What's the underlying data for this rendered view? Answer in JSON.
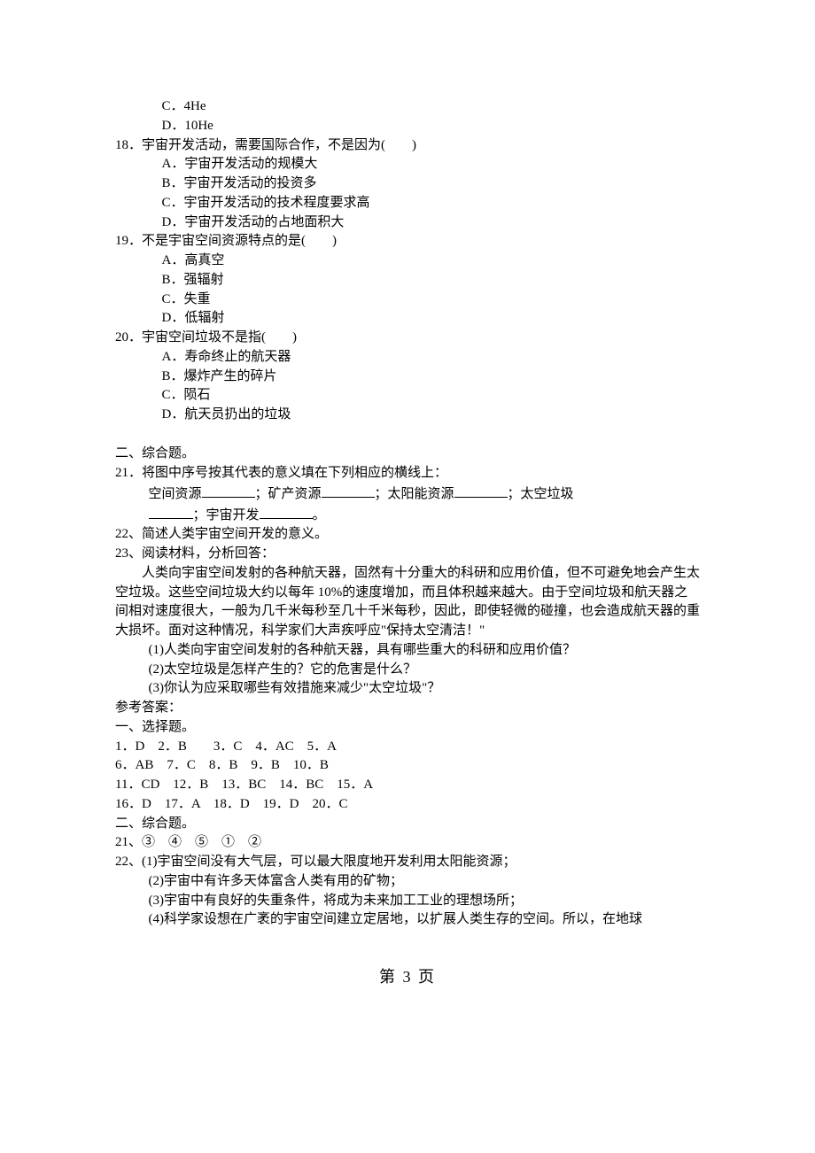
{
  "options": {
    "o1": "C．4He",
    "o2": "D．10He"
  },
  "q18": {
    "stem": "18．宇宙开发活动，需要国际合作，不是因为(　　)",
    "a": "A．宇宙开发活动的规模大",
    "b": "B．宇宙开发活动的投资多",
    "c": "C．宇宙开发活动的技术程度要求高",
    "d": "D．宇宙开发活动的占地面积大"
  },
  "q19": {
    "stem": "19．不是宇宙空间资源特点的是(　　)",
    "a": "A．高真空",
    "b": "B．强辐射",
    "c": "C．失重",
    "d": "D．低辐射"
  },
  "q20": {
    "stem": "20．宇宙空间垃圾不是指(　　)",
    "a": "A．寿命终止的航天器",
    "b": "B．爆炸产生的碎片",
    "c": "C．陨石",
    "d": "D．航天员扔出的垃圾"
  },
  "section2": "二、综合题。",
  "q21": {
    "stem": "21．将图中序号按其代表的意义填在下列相应的横线上：",
    "line1a": "空间资源",
    "line1b": "；矿产资源",
    "line1c": "；太阳能资源",
    "line1d": "；太空垃圾",
    "line2a": "；宇宙开发",
    "line2b": "。"
  },
  "q22": "22、简述人类宇宙空间开发的意义。",
  "q23": {
    "stem": "23、阅读材料，分析回答：",
    "p1": "人类向宇宙空间发射的各种航天器，固然有十分重大的科研和应用价值，但不可避免地会产生太空垃圾。这些空间垃圾大约以每年 10%的速度增加，而且体积越来越大。由于空间垃圾和航天器之间相对速度很大，一般为几千米每秒至几十千米每秒，因此，即使轻微的碰撞，也会造成航天器的重大损坏。面对这种情况，科学家们大声疾呼应\"保持太空清洁！\"",
    "sub1": "(1)人类向宇宙空间发射的各种航天器，具有哪些重大的科研和应用价值？",
    "sub2": "(2)太空垃圾是怎样产生的？它的危害是什么？",
    "sub3": "(3)你认为应采取哪些有效措施来减少\"太空垃圾\"？"
  },
  "answers": {
    "title": "参考答案：",
    "sec1": "一、选择题。",
    "l1": "1．D　2．B　　3．C　4．AC　5．A",
    "l2": "6．AB　7．C　8．B　9．B　10．B",
    "l3": "11．CD　12．B　13．BC　14．BC　15．A",
    "l4": "16．D　17．A　18．D　19．D　20．C",
    "sec2": "二、综合题。",
    "a21": "21、③　④　⑤　①　②",
    "a22_1": "22、(1)宇宙空间没有大气层，可以最大限度地开发利用太阳能资源；",
    "a22_2": "(2)宇宙中有许多天体富含人类有用的矿物；",
    "a22_3": "(3)宇宙中有良好的失重条件，将成为未来加工工业的理想场所；",
    "a22_4": "(4)科学家设想在广袤的宇宙空间建立定居地，以扩展人类生存的空间。所以，在地球"
  },
  "pageNumber": "第 3 页"
}
